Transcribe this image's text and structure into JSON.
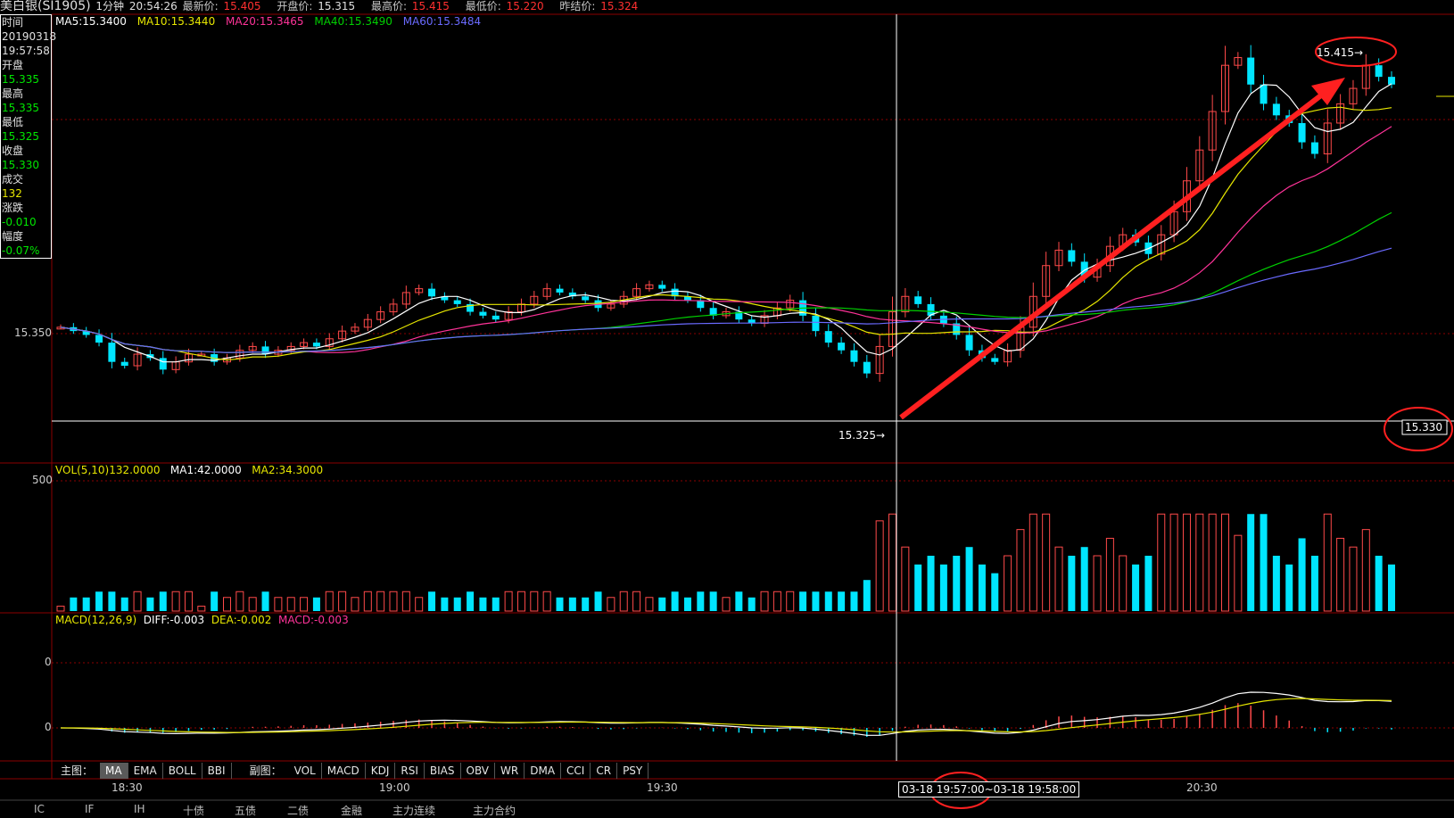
{
  "header": {
    "symbol": "美白银(SI1905)",
    "period": "1分钟",
    "clock": "20:54:26",
    "last_label": "最新价:",
    "last": "15.405",
    "open_label": "开盘价:",
    "open": "15.315",
    "high_label": "最高价:",
    "high": "15.415",
    "low_label": "最低价:",
    "low": "15.220",
    "prev_label": "昨结价:",
    "prev": "15.324"
  },
  "info": {
    "time_label": "时间",
    "date": "20190318",
    "time": "19:57:58",
    "open_label": "开盘",
    "open": "15.335",
    "high_label": "最高",
    "high": "15.335",
    "low_label": "最低",
    "low": "15.325",
    "close_label": "收盘",
    "close": "15.330",
    "vol_label": "成交",
    "vol": "132",
    "chg_label": "涨跌",
    "chg": "-0.010",
    "pct_label": "幅度",
    "pct": "-0.07%"
  },
  "ma_bar": {
    "ma5": "MA5:15.3400",
    "ma10": "MA10:15.3440",
    "ma20": "MA20:15.3465",
    "ma40": "MA40:15.3490",
    "ma60": "MA60:15.3484"
  },
  "vol_bar": {
    "vol": "VOL(5,10)132.0000",
    "ma1": "MA1:42.0000",
    "ma2": "MA2:34.3000"
  },
  "macd_bar": {
    "title": "MACD(12,26,9)",
    "diff": "DIFF:-0.003",
    "dea": "DEA:-0.002",
    "macd": "MACD:-0.003"
  },
  "annotations": {
    "high_marker": "15.415",
    "low_marker": "15.325",
    "cursor_price": "15.330",
    "cursor_time_left": "03-18",
    "cursor_time_mid": "19:57:00",
    "cursor_time_right": "03-18 19:58:00"
  },
  "tabs": {
    "main_label": "主图：",
    "main": [
      "MA",
      "EMA",
      "BOLL",
      "BBI"
    ],
    "sub_label": "副图：",
    "sub": [
      "VOL",
      "MACD",
      "KDJ",
      "RSI",
      "BIAS",
      "OBV",
      "WR",
      "DMA",
      "CCI",
      "CR",
      "PSY"
    ]
  },
  "bottom_tabs": [
    "IC",
    "IF",
    "IH",
    "十债",
    "五债",
    "二债",
    "金融",
    "主力连续",
    "主力合约"
  ],
  "colors": {
    "up": "#ff4a4a",
    "down": "#00e5ff",
    "ma5": "#ffffff",
    "ma10": "#e6e600",
    "ma20": "#ff3399",
    "ma40": "#00d000",
    "ma60": "#6a6aff",
    "grid": "#8b0000",
    "arrow": "#ff2020"
  },
  "chart_data": {
    "type": "candlestick",
    "title": "美白银(SI1905) 1分钟",
    "x_ticks": [
      "18:30",
      "19:00",
      "19:30",
      "20:30"
    ],
    "y_ticks": [
      15.35
    ],
    "volume_y_tick": 500,
    "macd_y_ticks": [
      0,
      0
    ],
    "ylim": [
      15.31,
      15.42
    ],
    "series": [
      {
        "name": "MA5",
        "values": [
          15.34
        ]
      },
      {
        "name": "MA10",
        "values": [
          15.344
        ]
      },
      {
        "name": "MA20",
        "values": [
          15.3465
        ]
      },
      {
        "name": "MA40",
        "values": [
          15.349
        ]
      },
      {
        "name": "MA60",
        "values": [
          15.3484
        ]
      }
    ],
    "close_approx": [
      15.342,
      15.341,
      15.34,
      15.338,
      15.333,
      15.332,
      15.335,
      15.334,
      15.331,
      15.333,
      15.335,
      15.335,
      15.333,
      15.334,
      15.336,
      15.337,
      15.335,
      15.336,
      15.337,
      15.338,
      15.337,
      15.339,
      15.341,
      15.342,
      15.344,
      15.346,
      15.348,
      15.351,
      15.352,
      15.35,
      15.349,
      15.348,
      15.346,
      15.345,
      15.344,
      15.346,
      15.348,
      15.35,
      15.352,
      15.351,
      15.35,
      15.349,
      15.347,
      15.348,
      15.35,
      15.352,
      15.353,
      15.352,
      15.35,
      15.349,
      15.347,
      15.345,
      15.346,
      15.344,
      15.343,
      15.345,
      15.347,
      15.349,
      15.345,
      15.341,
      15.338,
      15.336,
      15.333,
      15.33,
      15.337,
      15.346,
      15.35,
      15.348,
      15.345,
      15.343,
      15.34,
      15.336,
      15.334,
      15.333,
      15.336,
      15.342,
      15.35,
      15.358,
      15.362,
      15.359,
      15.355,
      15.358,
      15.363,
      15.366,
      15.364,
      15.361,
      15.366,
      15.372,
      15.38,
      15.388,
      15.398,
      15.41,
      15.412,
      15.405,
      15.4,
      15.397,
      15.395,
      15.39,
      15.387,
      15.395,
      15.4,
      15.404,
      15.41,
      15.407,
      15.405
    ]
  }
}
